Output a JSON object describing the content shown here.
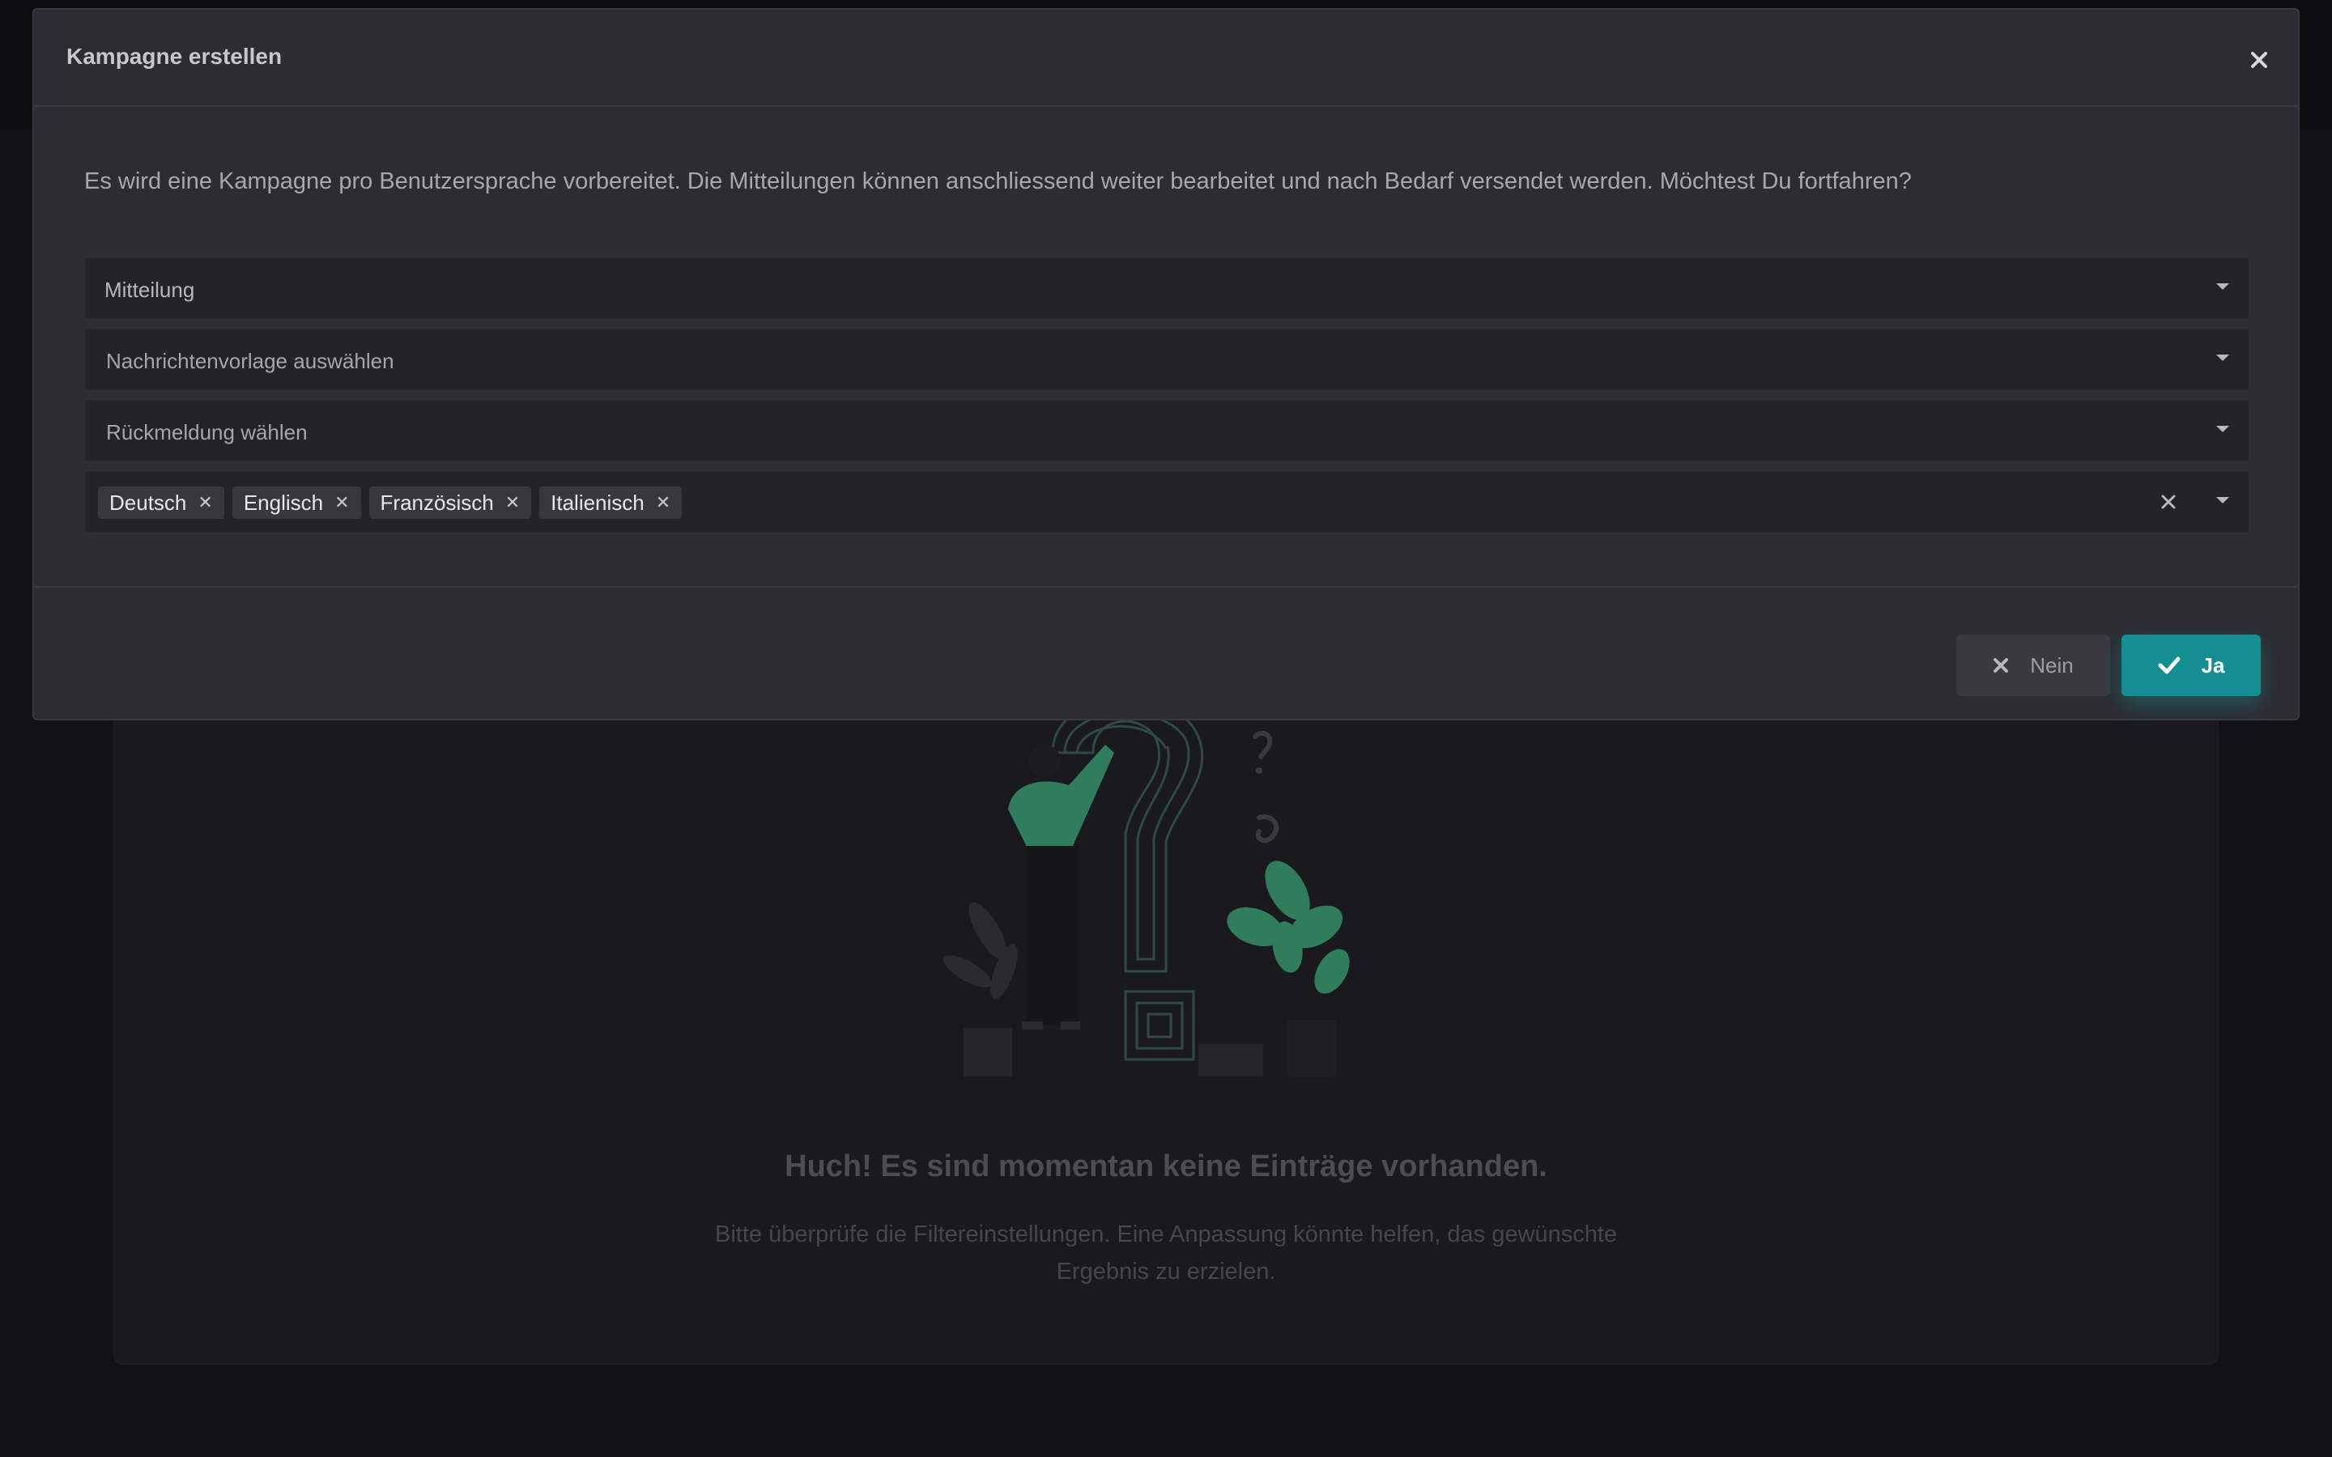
{
  "modal": {
    "title": "Kampagne erstellen",
    "description": "Es wird eine Kampagne pro Benutzersprache vorbereitet. Die Mitteilungen können anschliessend weiter bearbeitet und nach Bedarf versendet werden. Möchtest Du fortfahren?",
    "fields": {
      "type": "Mitteilung",
      "template_placeholder": "Nachrichtenvorlage auswählen",
      "feedback_placeholder": "Rückmeldung wählen"
    },
    "languages": [
      "Deutsch",
      "Englisch",
      "Französisch",
      "Italienisch"
    ],
    "buttons": {
      "no": "Nein",
      "yes": "Ja"
    },
    "colors": {
      "accent": "#138f91"
    }
  },
  "empty_state": {
    "title": "Huch! Es sind momentan keine Einträge vorhanden.",
    "text": "Bitte überprüfe die Filtereinstellungen. Eine Anpassung könnte helfen, das gewünschte Ergebnis zu erzielen."
  }
}
